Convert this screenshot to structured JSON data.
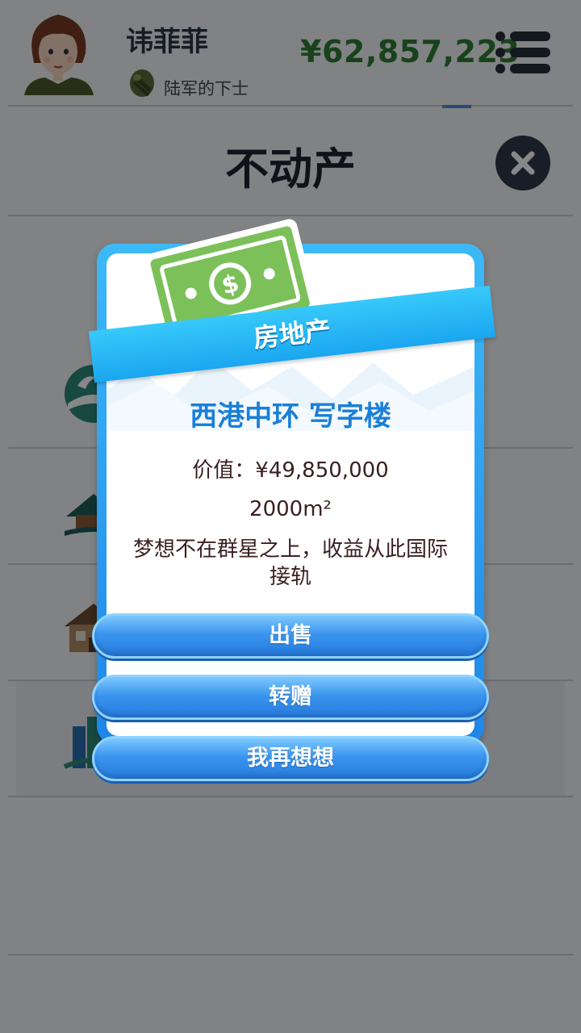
{
  "header": {
    "username": "讳菲菲",
    "rank": "陆军的下士",
    "money": "¥62,857,223",
    "icons": {
      "avatar": "female-avatar",
      "rank": "rank-badge-icon",
      "menu": "menu-icon"
    }
  },
  "section": {
    "title": "不动产",
    "close_icon": "close-icon"
  },
  "property_list": [
    {
      "icon": "resort-icon"
    },
    {
      "icon": "villa-icon"
    },
    {
      "icon": "house-icon"
    },
    {
      "icon": "office-building-icon"
    }
  ],
  "dialog": {
    "badge_icon": "money-bill-icon",
    "ribbon": "房地产",
    "name": "西港中环 写字楼",
    "price": "价值：¥49,850,000",
    "area": "2000m²",
    "description": "梦想不在群星之上，收益从此国际接轨",
    "buttons": {
      "sell": "出售",
      "gift": "转赠",
      "cancel": "我再想想"
    }
  },
  "colors": {
    "money": "#2f7d36",
    "title": "#1e2530",
    "dialog_accent": "#1f86e8",
    "property_name": "#1a7fd8"
  }
}
